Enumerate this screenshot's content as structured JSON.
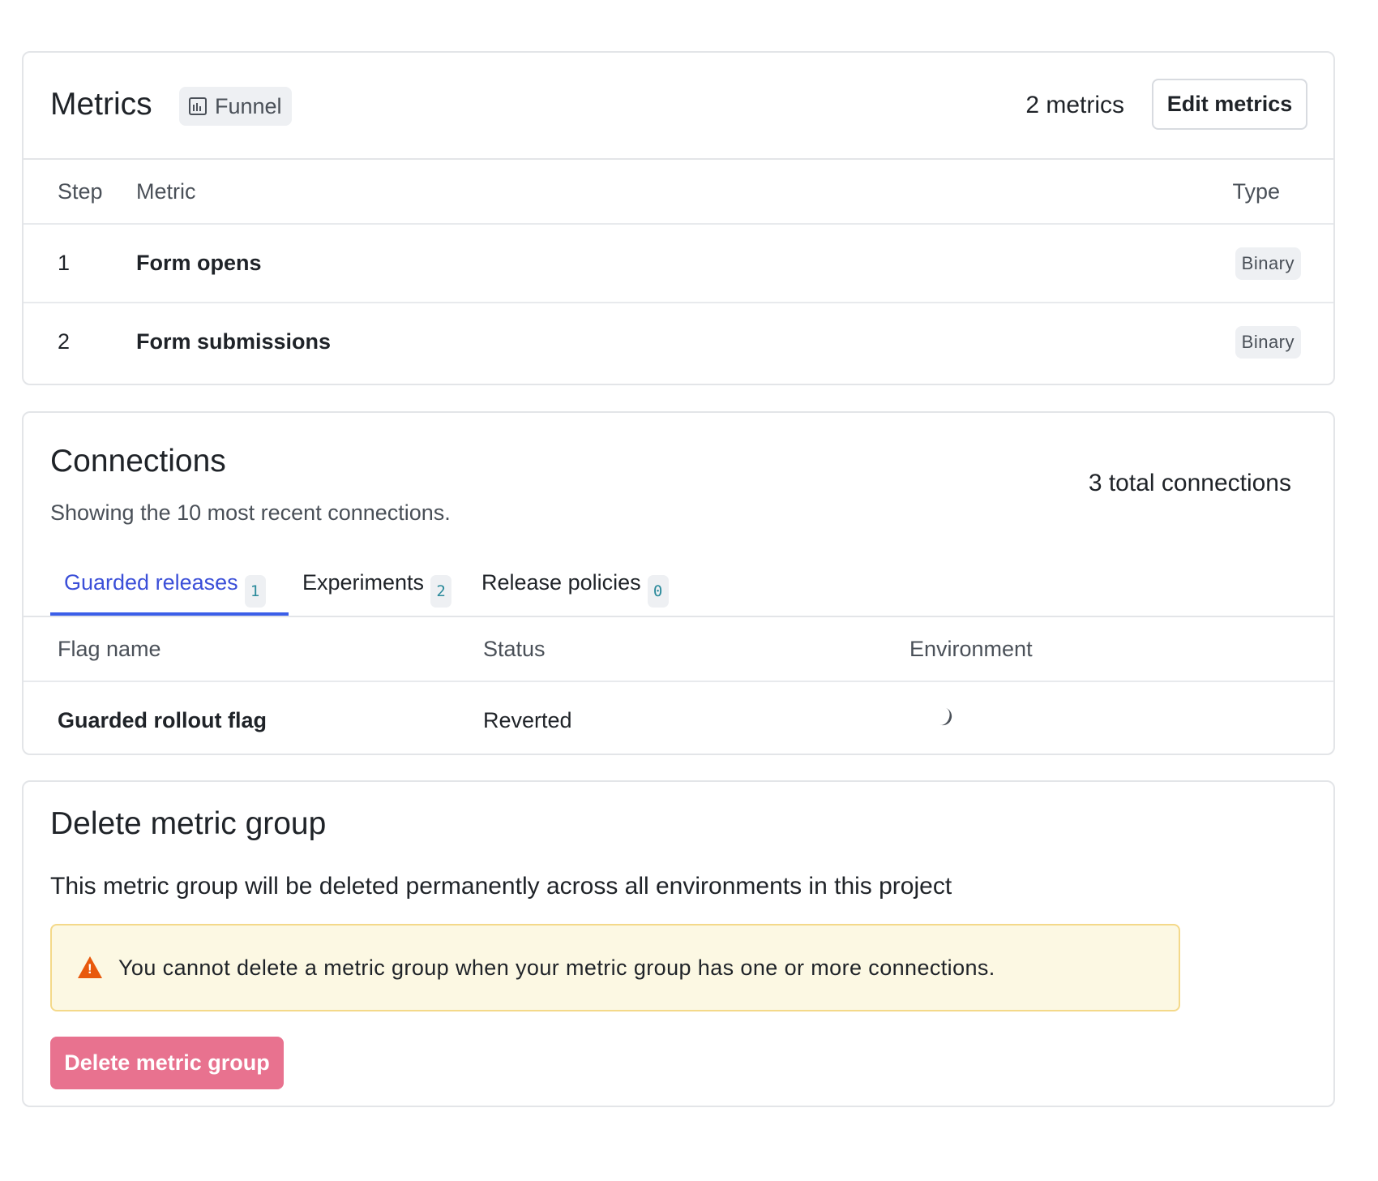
{
  "metrics": {
    "title": "Metrics",
    "badge_label": "Funnel",
    "badge_icon": "funnel-chart-icon",
    "count_text": "2 metrics",
    "edit_button_label": "Edit metrics",
    "columns": [
      "Step",
      "Metric",
      "Type"
    ],
    "rows": [
      {
        "step": "1",
        "name": "Form opens",
        "type": "Binary"
      },
      {
        "step": "2",
        "name": "Form submissions",
        "type": "Binary"
      }
    ]
  },
  "connections": {
    "title": "Connections",
    "subtitle": "Showing the 10 most recent connections.",
    "total_text": "3 total connections",
    "tabs": [
      {
        "label": "Guarded releases",
        "count": "1",
        "active": true
      },
      {
        "label": "Experiments",
        "count": "2",
        "active": false
      },
      {
        "label": "Release policies",
        "count": "0",
        "active": false
      }
    ],
    "columns": [
      "Flag name",
      "Status",
      "Environment"
    ],
    "rows": [
      {
        "flag": "Guarded rollout flag",
        "status": "Reverted",
        "environment_icon": "loading-spinner-icon"
      }
    ]
  },
  "delete_group": {
    "title": "Delete metric group",
    "description": "This metric group will be deleted permanently across all environments in this project",
    "warning_text": "You cannot delete a metric group when your metric group has one or more connections.",
    "warning_icon": "warning-triangle-icon",
    "button_label": "Delete metric group",
    "button_disabled": true
  },
  "colors": {
    "accent": "#3b5ee8",
    "warning_bg": "#fcf8e3",
    "warning_border": "#f4d98a",
    "warning_icon": "#e8590c",
    "danger_disabled": "#e8728f"
  }
}
